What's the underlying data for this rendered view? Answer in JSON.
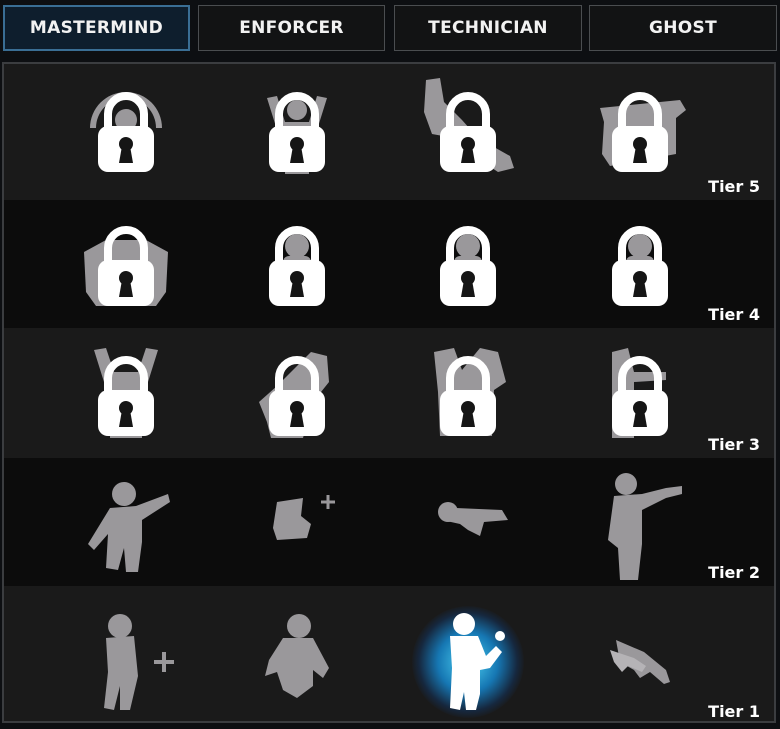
{
  "tabs": [
    {
      "label": "MASTERMIND",
      "active": true
    },
    {
      "label": "ENFORCER",
      "active": false
    },
    {
      "label": "TECHNICIAN",
      "active": false
    },
    {
      "label": "GHOST",
      "active": false
    }
  ],
  "tiers": [
    {
      "label": "Tier 5",
      "skills": [
        {
          "icon": "arc-figure-icon",
          "locked": true
        },
        {
          "icon": "figure-arms-up-icon",
          "locked": true
        },
        {
          "icon": "leaping-figure-icon",
          "locked": true
        },
        {
          "icon": "weapon-crate-icon",
          "locked": true
        }
      ]
    },
    {
      "label": "Tier 4",
      "skills": [
        {
          "icon": "two-figures-icon",
          "locked": true
        },
        {
          "icon": "standing-figure-icon",
          "locked": true
        },
        {
          "icon": "standing-figure-icon",
          "locked": true
        },
        {
          "icon": "standing-figure-icon",
          "locked": true
        }
      ]
    },
    {
      "label": "Tier 3",
      "skills": [
        {
          "icon": "figure-arms-up-icon",
          "locked": true
        },
        {
          "icon": "crouching-figure-icon",
          "locked": true
        },
        {
          "icon": "two-figures-icon",
          "locked": true
        },
        {
          "icon": "figure-with-gun-icon",
          "locked": true
        }
      ]
    },
    {
      "label": "Tier 2",
      "skills": [
        {
          "icon": "pointing-figure-icon",
          "locked": false
        },
        {
          "icon": "medic-bag-plus-icon",
          "locked": false
        },
        {
          "icon": "lying-figure-icon",
          "locked": false
        },
        {
          "icon": "figure-aiming-pistol-icon",
          "locked": false
        }
      ]
    },
    {
      "label": "Tier 1",
      "skills": [
        {
          "icon": "figure-plus-icon",
          "locked": false
        },
        {
          "icon": "kneeling-figure-icon",
          "locked": false
        },
        {
          "icon": "figure-holding-cup-icon",
          "locked": false,
          "selected": true
        },
        {
          "icon": "pistols-icon",
          "locked": false
        }
      ]
    }
  ],
  "colors": {
    "accent": "#3a6e94",
    "selected_glow": "#19a6e8",
    "icon_grey": "#9a989b",
    "lock_white": "#ffffff"
  }
}
